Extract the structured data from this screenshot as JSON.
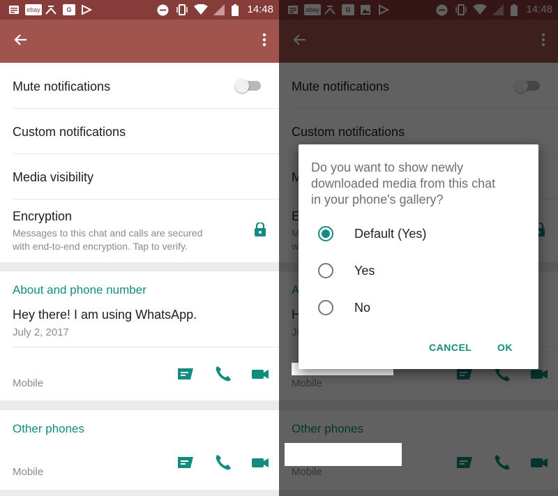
{
  "status_bar": {
    "time": "14:48",
    "left_icons": [
      "news-icon",
      "ebay-icon",
      "tool-icon",
      "g-icon",
      "flag-icon"
    ],
    "left_icons_right_panel": [
      "news-icon",
      "ebay-icon",
      "tool-icon",
      "g-icon",
      "image-icon",
      "flag-icon"
    ],
    "ebay_text": "ebay",
    "g_text": "G"
  },
  "colors": {
    "status_bar": "#863c38",
    "toolbar": "#a1534e",
    "accent": "#128c7e",
    "divider": "#e6e6e6"
  },
  "settings": {
    "mute_label": "Mute notifications",
    "mute_on": false,
    "custom_label": "Custom notifications",
    "media_label": "Media visibility",
    "encryption_title": "Encryption",
    "encryption_sub_1": "Messages to this chat and calls are secured",
    "encryption_sub_2": "with end-to-end encryption. Tap to verify."
  },
  "about": {
    "header": "About and phone number",
    "status": "Hey there! I am using WhatsApp.",
    "date": "July 2, 2017",
    "phone_label": "Mobile"
  },
  "other_phones": {
    "header": "Other phones",
    "phone_label": "Mobile"
  },
  "dialog": {
    "question_1": "Do you want to show newly",
    "question_2": "downloaded media from this chat",
    "question_3": "in your phone's gallery?",
    "options": [
      "Default (Yes)",
      "Yes",
      "No"
    ],
    "selected": "Default (Yes)",
    "cancel": "CANCEL",
    "ok": "OK"
  }
}
